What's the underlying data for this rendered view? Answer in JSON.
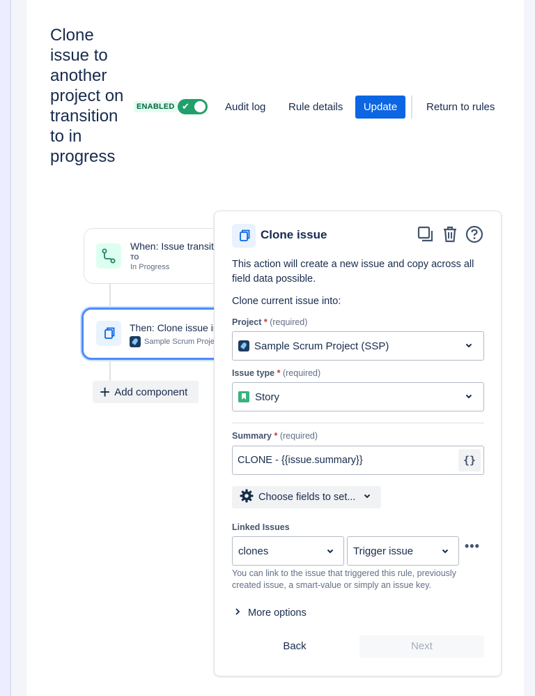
{
  "rule": {
    "title": "Clone issue to another project on transition to in progress",
    "status_badge": "ENABLED",
    "toggle_on": true
  },
  "header": {
    "audit_log": "Audit log",
    "rule_details": "Rule details",
    "update": "Update",
    "return_to_rules": "Return to rules"
  },
  "flow": {
    "trigger_title": "When: Issue transitioned",
    "trigger_to_label": "TO",
    "trigger_status": "In Progress",
    "action_title": "Then: Clone issue into",
    "action_project": "Sample Scrum Project",
    "add_component": "Add component"
  },
  "panel": {
    "title": "Clone issue",
    "description": "This action will create a new issue and copy across all field data possible.",
    "clone_into_label": "Clone current issue into:",
    "project_label": "Project",
    "project_value": "Sample Scrum Project (SSP)",
    "issue_type_label": "Issue type",
    "issue_type_value": "Story",
    "required_marker": "*",
    "required_text": "(required)",
    "summary_label": "Summary",
    "summary_value": "CLONE - {{issue.summary}}",
    "smart_value_button": "{}",
    "choose_fields": "Choose fields to set...",
    "linked_issues_label": "Linked Issues",
    "link_type_value": "clones",
    "link_target_value": "Trigger issue",
    "more_icon": "•••",
    "linked_help": "You can link to the issue that triggered this rule, previously created issue, a smart-value or simply an issue key.",
    "more_options": "More options",
    "back": "Back",
    "next": "Next"
  },
  "colors": {
    "accent": "#0c66e4",
    "enabled_green": "#22a06b",
    "required_red": "#c9372c"
  }
}
